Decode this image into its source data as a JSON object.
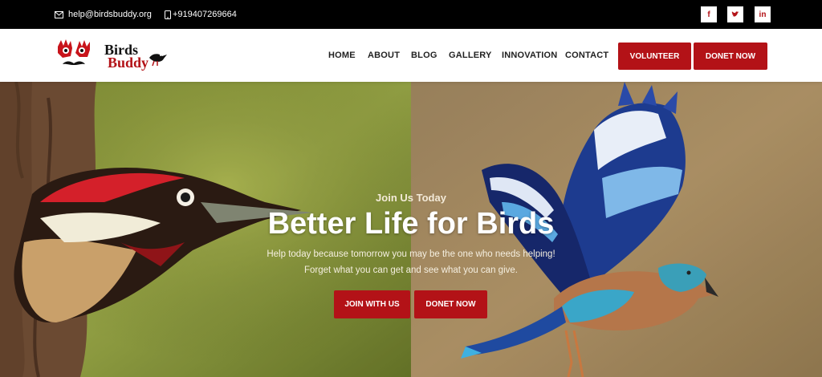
{
  "topbar": {
    "email": "help@birdsbuddy.org",
    "phone": "+919407269664",
    "email_icon": "envelope-icon",
    "phone_icon": "mobile-phone-icon",
    "social": [
      {
        "name": "facebook",
        "glyph": "f"
      },
      {
        "name": "twitter",
        "glyph": "t"
      },
      {
        "name": "linkedin",
        "glyph": "in"
      }
    ]
  },
  "header": {
    "logo_text_line1": "Birds",
    "logo_text_line2": "Buddy",
    "nav": [
      "HOME",
      "ABOUT",
      "BLOG",
      "GALLERY",
      "INNOVATION",
      "CONTACT"
    ],
    "volunteer_label": "VOLUNTEER",
    "donate_label": "DONET NOW"
  },
  "hero": {
    "kicker": "Join Us Today",
    "title": "Better Life for Birds",
    "subtitle_line1": "Help today because tomorrow you may be the one who needs helping!",
    "subtitle_line2": "Forget what you can get and see what you can give.",
    "join_label": "JOIN WITH US",
    "donate_label": "DONET NOW"
  },
  "colors": {
    "accent": "#b31217",
    "topbar_bg": "#000000",
    "header_bg": "#ffffff"
  }
}
